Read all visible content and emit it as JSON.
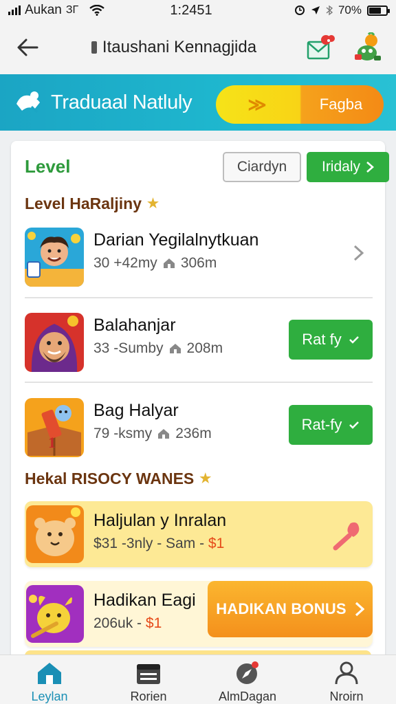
{
  "status_bar": {
    "carrier": "Aukan",
    "network": "ЗГ",
    "time": "1:2451",
    "battery": "70%",
    "battery_level": 0.7
  },
  "header": {
    "title": "Itaushani Kennagjida",
    "back_icon": "arrow-left-icon",
    "mail_icon": "mail-icon",
    "avatar_icon": "mascot-avatar-icon"
  },
  "banner": {
    "title": "Traduaal Natluly",
    "pill_label": "Fagba",
    "pill_arrow": "≫"
  },
  "card": {
    "level_title": "Level",
    "outline_button": "Ciardyn",
    "green_button": "Iridaly"
  },
  "section1": {
    "title": "Level HaRaljiny",
    "items": [
      {
        "name": "Darian Yegilalnytkuan",
        "meta1": "30 +42my",
        "meta2": "306m",
        "action": "chevron"
      },
      {
        "name": "Balahanjar",
        "meta1": "33 -Sumby",
        "meta2": "208m",
        "action": "Rat fy"
      },
      {
        "name": "Bag Halyar",
        "meta1": "79 -ksmy",
        "meta2": "236m",
        "action": "Rat-fy"
      }
    ]
  },
  "section2": {
    "title": "Hekal RISOCY WANES",
    "promo1": {
      "name": "Haljulan y Inralan",
      "meta_a": "$31 -3nly - Sam -",
      "meta_b": "$1"
    },
    "promo2": {
      "name": "Hadikan Eagi",
      "meta_a": "206uk -",
      "meta_b": "$1",
      "button": "HADIKAN BONUS"
    }
  },
  "tabbar": {
    "tabs": [
      {
        "label": "Leylan",
        "icon": "home-icon",
        "active": true
      },
      {
        "label": "Rorien",
        "icon": "calendar-icon",
        "active": false
      },
      {
        "label": "AlmDagan",
        "icon": "compass-icon",
        "active": false
      },
      {
        "label": "Nroirn",
        "icon": "profile-icon",
        "active": false
      }
    ]
  },
  "colors": {
    "banner": "#1fb8cf",
    "primary_green": "#2fae3f",
    "section_title": "#6b3510",
    "active_tab": "#1a8fb5",
    "promo_bg": "#fde995",
    "bonus_orange": "#f4901c"
  }
}
